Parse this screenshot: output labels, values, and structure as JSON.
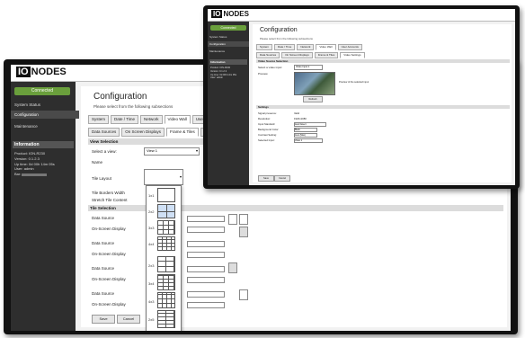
{
  "app": {
    "logo_box": "IO",
    "logo_text": "NODES"
  },
  "sidebar": {
    "connected": "Connected",
    "items": [
      "System Status",
      "Configuration",
      "Maintenance"
    ],
    "info_title": "Information",
    "info": [
      {
        "k": "Product:",
        "v": "ION-R230"
      },
      {
        "k": "Version:",
        "v": "0.1.2.3"
      },
      {
        "k": "Up time:",
        "v": "0d 00h 14m 05s"
      },
      {
        "k": "User:",
        "v": "admin"
      },
      {
        "k": "Bar:",
        "v": ""
      }
    ]
  },
  "main": {
    "title": "Configuration",
    "subtitle": "Please select from the following subsections",
    "tabs": [
      "System",
      "Date / Time",
      "Network",
      "Video Wall",
      "User Accounts"
    ],
    "subtabs": [
      "Data Sources",
      "On Screen Displays",
      "Frame & Tiles",
      "Video Settings"
    ],
    "view_section": "View Selection",
    "view_rows": {
      "select_view": "Select a view:",
      "view_value": "View 1",
      "name": "Name",
      "tile_layout": "Tile Layout",
      "borders": "Tile Borders Width",
      "stretch": "Stretch Tile Content"
    },
    "tile_section": "Tile Selection",
    "tile_rows": [
      "Data Source",
      "On-Screen Display",
      "Data Source",
      "On-Screen Display",
      "Data Source",
      "On-Screen Display",
      "Data Source",
      "On-Screen Display"
    ],
    "layout_options": [
      "1x1",
      "2x2",
      "3x3",
      "4x4",
      "2x3",
      "3x4",
      "4x3",
      "2x5"
    ],
    "buttons": {
      "save": "Save",
      "cancel": "Cancel"
    }
  },
  "back": {
    "connected": "Connected",
    "items": [
      "System Status",
      "Configuration",
      "Maintenance"
    ],
    "info_title": "Information",
    "tabs": [
      "System",
      "Date / Time",
      "Network",
      "Video Wall",
      "User Accounts"
    ],
    "subtabs": [
      "Data Sources",
      "On Screen Displays",
      "Frame & Tiles",
      "Video Settings"
    ],
    "section1": "Video Source Selection",
    "source_label": "Select a video input:",
    "source_value": "Video Input 1",
    "preview_label": "Preview",
    "preview_note": "Preview of the selected input",
    "refresh": "Refresh",
    "section2": "Settings",
    "settings": [
      {
        "k": "Signal presence:",
        "v": "Valid"
      },
      {
        "k": "Resolution:",
        "v": "1920x1080"
      },
      {
        "k": "Input Standard:",
        "v": "Auto Detect"
      },
      {
        "k": "Background Color:",
        "v": "Black"
      },
      {
        "k": "Contrast Setting:",
        "v": "Auto (Max)"
      },
      {
        "k": "Selected Input:",
        "v": "Video 1"
      }
    ],
    "save": "Save",
    "cancel": "Cancel"
  }
}
